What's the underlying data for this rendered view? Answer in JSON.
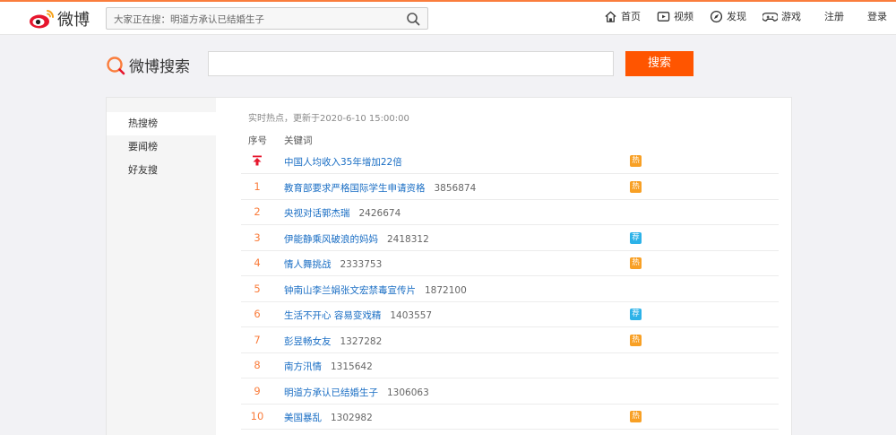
{
  "topnav": {
    "logo_text": "微博",
    "search_placeholder": "大家正在搜：明道方承认已结婚生子",
    "items": [
      {
        "label": "首页",
        "icon": "home-icon"
      },
      {
        "label": "视频",
        "icon": "video-icon"
      },
      {
        "label": "发现",
        "icon": "compass-icon"
      },
      {
        "label": "游戏",
        "icon": "gamepad-icon"
      }
    ],
    "register": "注册",
    "login": "登录"
  },
  "search": {
    "title": "微博搜索",
    "button": "搜索",
    "value": ""
  },
  "sidebar": {
    "items": [
      "热搜榜",
      "要闻榜",
      "好友搜"
    ],
    "active": 0
  },
  "list": {
    "updated": "实时热点，更新于2020-6-10 15:00:00",
    "col_rank": "序号",
    "col_keyword": "关键词",
    "rows": [
      {
        "rank": "",
        "pinned": true,
        "keyword": "中国人均收入35年增加22倍",
        "count": "",
        "badge": "热",
        "badge_color": "#f8a025"
      },
      {
        "rank": "1",
        "keyword": "教育部要求严格国际学生申请资格",
        "count": "3856874",
        "badge": "热",
        "badge_color": "#f8a025"
      },
      {
        "rank": "2",
        "keyword": "央视对话郭杰瑞",
        "count": "2426674",
        "badge": "",
        "badge_color": ""
      },
      {
        "rank": "3",
        "keyword": "伊能静乘风破浪的妈妈",
        "count": "2418312",
        "badge": "荐",
        "badge_color": "#2cb2e8"
      },
      {
        "rank": "4",
        "keyword": "情人舞挑战",
        "count": "2333753",
        "badge": "热",
        "badge_color": "#f8a025"
      },
      {
        "rank": "5",
        "keyword": "钟南山李兰娟张文宏禁毒宣传片",
        "count": "1872100",
        "badge": "",
        "badge_color": ""
      },
      {
        "rank": "6",
        "keyword": "生活不开心 容易变戏精",
        "count": "1403557",
        "badge": "荐",
        "badge_color": "#2cb2e8"
      },
      {
        "rank": "7",
        "keyword": "彭昱畅女友",
        "count": "1327282",
        "badge": "热",
        "badge_color": "#f8a025"
      },
      {
        "rank": "8",
        "keyword": "南方汛情",
        "count": "1315642",
        "badge": "",
        "badge_color": ""
      },
      {
        "rank": "9",
        "keyword": "明道方承认已结婚生子",
        "count": "1306063",
        "badge": "",
        "badge_color": ""
      },
      {
        "rank": "10",
        "keyword": "美国暴乱",
        "count": "1302982",
        "badge": "热",
        "badge_color": "#f8a025"
      }
    ]
  }
}
